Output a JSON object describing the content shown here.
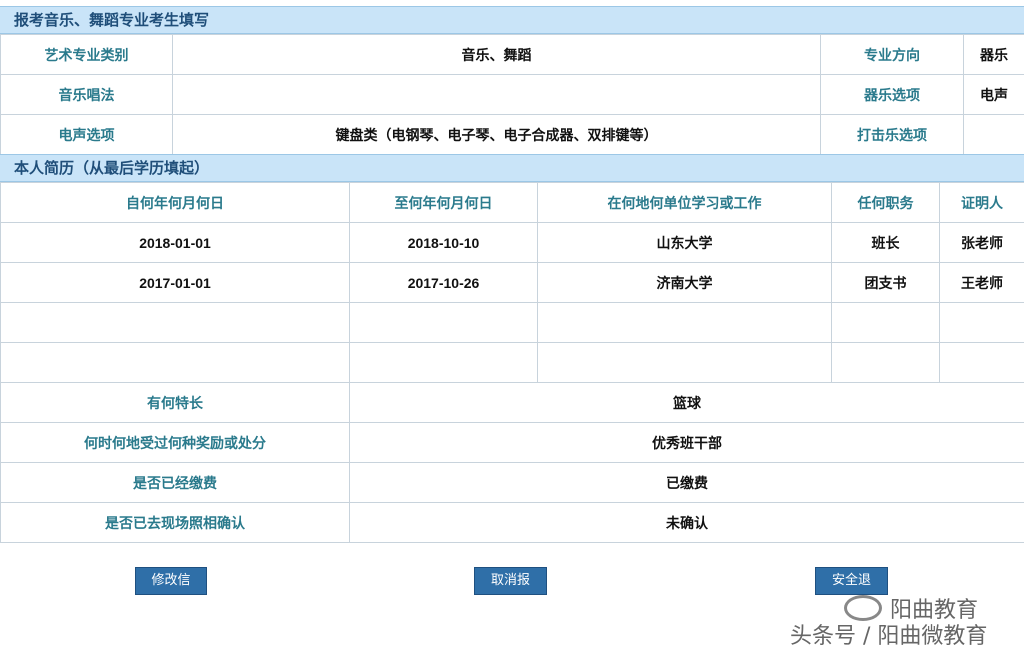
{
  "section1": {
    "title": "报考音乐、舞蹈专业考生填写",
    "rows": [
      {
        "l1": "艺术专业类别",
        "v1": "音乐、舞蹈",
        "l2": "专业方向",
        "v2": "器乐"
      },
      {
        "l1": "音乐唱法",
        "v1": "",
        "l2": "器乐选项",
        "v2": "电声"
      },
      {
        "l1": "电声选项",
        "v1": "键盘类（电钢琴、电子琴、电子合成器、双排键等）",
        "l2": "打击乐选项",
        "v2": ""
      }
    ]
  },
  "section2": {
    "title": "本人简历（从最后学历填起）",
    "headers": [
      "自何年何月何日",
      "至何年何月何日",
      "在何地何单位学习或工作",
      "任何职务",
      "证明人"
    ],
    "rows": [
      [
        "2018-01-01",
        "2018-10-10",
        "山东大学",
        "班长",
        "张老师"
      ],
      [
        "2017-01-01",
        "2017-10-26",
        "济南大学",
        "团支书",
        "王老师"
      ],
      [
        "",
        "",
        "",
        "",
        ""
      ],
      [
        "",
        "",
        "",
        "",
        ""
      ]
    ],
    "extra": [
      {
        "label": "有何特长",
        "value": "篮球"
      },
      {
        "label": "何时何地受过何种奖励或处分",
        "value": "优秀班干部"
      },
      {
        "label": "是否已经缴费",
        "value": "已缴费"
      },
      {
        "label": "是否已去现场照相确认",
        "value": "未确认"
      }
    ]
  },
  "buttons": {
    "edit": "修改信息",
    "cancel": "取消报名",
    "logout": "安全退出"
  },
  "watermark": {
    "line1": "阳曲教育",
    "line2": "头条号 / 阳曲微教育"
  }
}
